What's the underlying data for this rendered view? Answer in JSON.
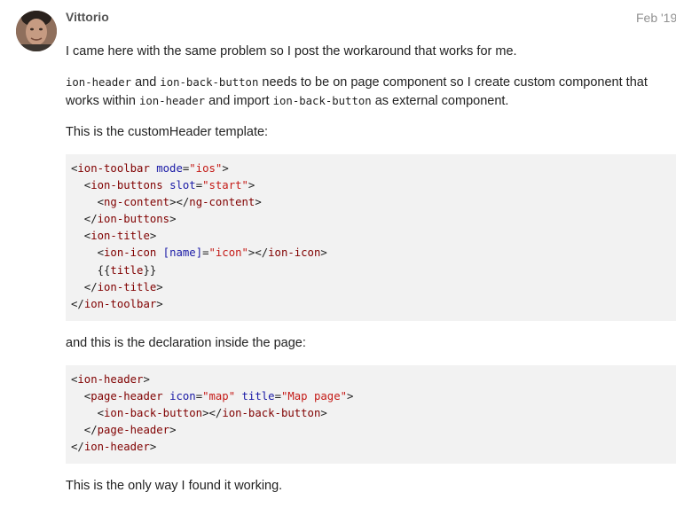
{
  "post": {
    "author": "Vittorio",
    "date": "Feb '19",
    "p1": "I came here with the same problem so I post the workaround that works for me.",
    "p2": {
      "code1": "ion-header",
      "t1": " and ",
      "code2": "ion-back-button",
      "t2": " needs to be on page component so I create custom component that works within ",
      "code3": "ion-header",
      "t3": " and import ",
      "code4": "ion-back-button",
      "t4": " as external component."
    },
    "p3": "This is the customHeader template:",
    "code_block_1": [
      [
        "<",
        "ion-toolbar",
        " ",
        "mode",
        "=",
        "\"ios\"",
        ">"
      ],
      [
        "  <",
        "ion-buttons",
        " ",
        "slot",
        "=",
        "\"start\"",
        ">"
      ],
      [
        "    <",
        "ng-content",
        "></",
        "ng-content",
        ">"
      ],
      [
        "  </",
        "ion-buttons",
        ">"
      ],
      [
        "  <",
        "ion-title",
        ">"
      ],
      [
        "    <",
        "ion-icon",
        " ",
        "[name]",
        "=",
        "\"icon\"",
        "></",
        "ion-icon",
        ">"
      ],
      [
        "    {{",
        "title",
        "}}"
      ],
      [
        "  </",
        "ion-title",
        ">"
      ],
      [
        "</",
        "ion-toolbar",
        ">"
      ]
    ],
    "p4": "and this is the declaration inside the page:",
    "code_block_2": [
      [
        "<",
        "ion-header",
        ">"
      ],
      [
        "  <",
        "page-header",
        " ",
        "icon",
        "=",
        "\"map\"",
        " ",
        "title",
        "=",
        "\"Map page\"",
        ">"
      ],
      [
        "    <",
        "ion-back-button",
        "></",
        "ion-back-button",
        ">"
      ],
      [
        "  </",
        "page-header",
        ">"
      ],
      [
        "</",
        "ion-header",
        ">"
      ]
    ],
    "p5": "This is the only way I found it working."
  }
}
